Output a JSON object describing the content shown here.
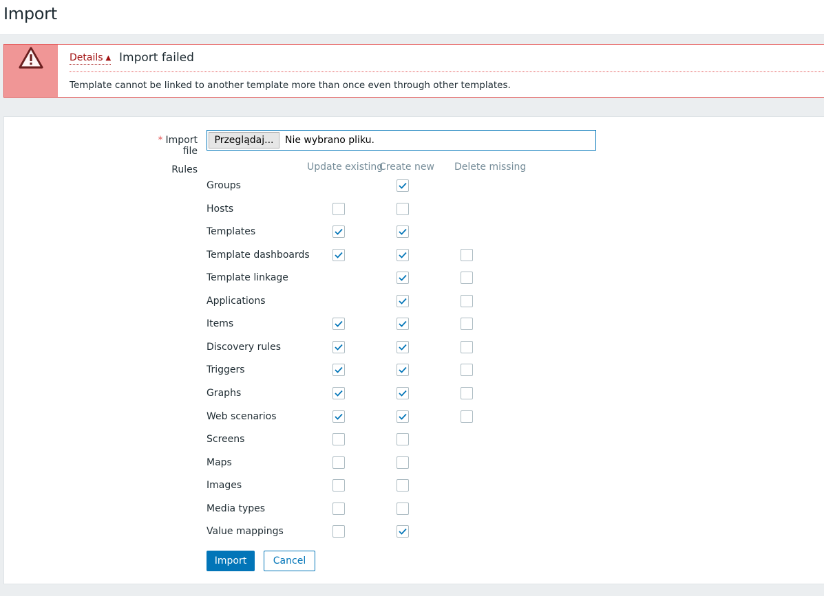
{
  "page": {
    "title": "Import"
  },
  "message": {
    "details_label": "Details",
    "details_arrow": "▲",
    "title": "Import failed",
    "text": "Template cannot be linked to another template more than once even through other templates."
  },
  "form": {
    "import_file_label": "Import file",
    "required_mark": "*",
    "browse_button": "Przeglądaj...",
    "file_status": "Nie wybrano pliku.",
    "rules_label": "Rules",
    "columns": [
      "Update existing",
      "Create new",
      "Delete missing"
    ],
    "rules": [
      {
        "name": "Groups",
        "update": null,
        "create": true,
        "delete": null
      },
      {
        "name": "Hosts",
        "update": false,
        "create": false,
        "delete": null
      },
      {
        "name": "Templates",
        "update": true,
        "create": true,
        "delete": null
      },
      {
        "name": "Template dashboards",
        "update": true,
        "create": true,
        "delete": false
      },
      {
        "name": "Template linkage",
        "update": null,
        "create": true,
        "delete": false
      },
      {
        "name": "Applications",
        "update": null,
        "create": true,
        "delete": false
      },
      {
        "name": "Items",
        "update": true,
        "create": true,
        "delete": false
      },
      {
        "name": "Discovery rules",
        "update": true,
        "create": true,
        "delete": false
      },
      {
        "name": "Triggers",
        "update": true,
        "create": true,
        "delete": false
      },
      {
        "name": "Graphs",
        "update": true,
        "create": true,
        "delete": false
      },
      {
        "name": "Web scenarios",
        "update": true,
        "create": true,
        "delete": false
      },
      {
        "name": "Screens",
        "update": false,
        "create": false,
        "delete": null
      },
      {
        "name": "Maps",
        "update": false,
        "create": false,
        "delete": null
      },
      {
        "name": "Images",
        "update": false,
        "create": false,
        "delete": null
      },
      {
        "name": "Media types",
        "update": false,
        "create": false,
        "delete": null
      },
      {
        "name": "Value mappings",
        "update": false,
        "create": true,
        "delete": null
      }
    ],
    "import_button": "Import",
    "cancel_button": "Cancel"
  },
  "colors": {
    "accent": "#0275b8",
    "error": "#e45959",
    "error_bg": "#f09696"
  }
}
